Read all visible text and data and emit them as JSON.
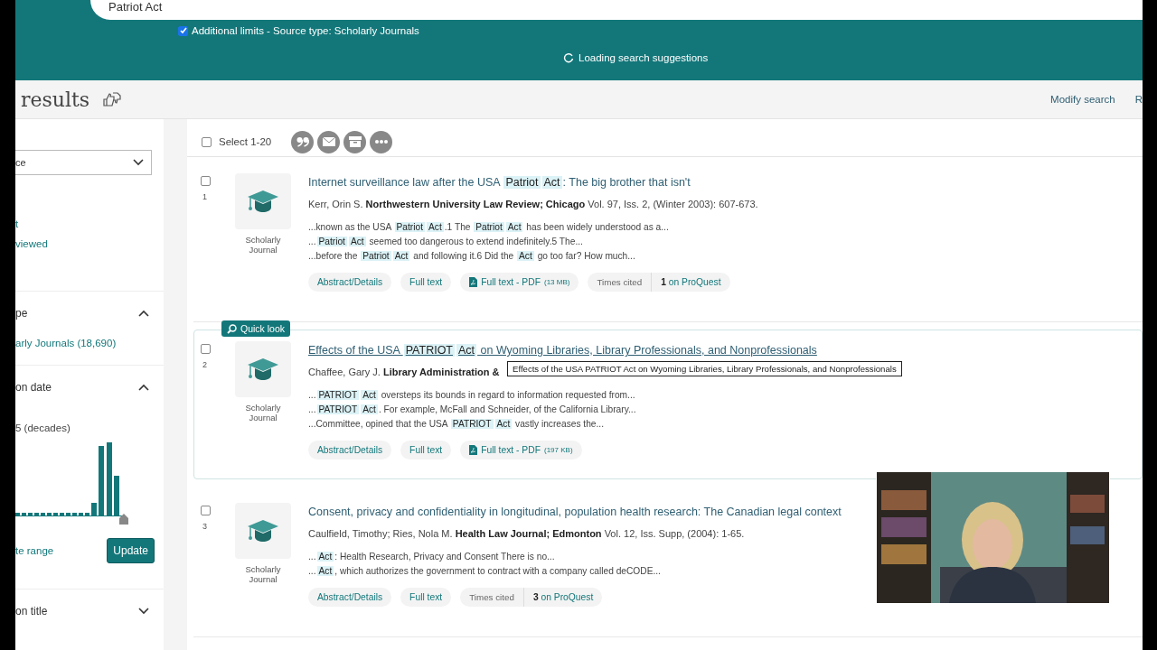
{
  "search": {
    "value": "Patriot Act",
    "limit": {
      "checked": true,
      "label": "Additional limits - Source type: Scholarly Journals"
    },
    "loading": "Loading search suggestions"
  },
  "heading": {
    "title": "results",
    "links": [
      "Modify search",
      "R"
    ]
  },
  "sidebar": {
    "dropdown": "ce",
    "sections": [
      {
        "kind": "links",
        "items": [
          "t",
          "viewed"
        ]
      },
      {
        "kind": "facet",
        "title": "pe",
        "expanded": true,
        "items": [
          "arly Journals (18,690)"
        ]
      },
      {
        "kind": "date",
        "title": "on date",
        "expanded": true,
        "caption": "5 (decades)",
        "link": "te range",
        "button": "Update"
      },
      {
        "kind": "facet",
        "title": "on title",
        "expanded": false
      }
    ]
  },
  "toolbar": {
    "select_all": {
      "checked": false,
      "label": "Select 1-20"
    }
  },
  "results": [
    {
      "number": "1",
      "selected": false,
      "hovered": false,
      "type_label": "Scholarly Journal",
      "title": [
        {
          "text": "Internet surveillance law after the USA ",
          "hit": false
        },
        {
          "text": "Patriot",
          "hit": true
        },
        {
          "text": "Act",
          "hit": true
        },
        {
          "text": ": The big brother that isn't",
          "hit": false
        }
      ],
      "byline": "Kerr, Orin S. **Northwestern University Law Review; Chicago** Vol. 97, Iss. 2,  (Winter 2003): 607-673.",
      "snippets": [
        [
          {
            "text": "...known as the USA ",
            "hit": false
          },
          {
            "text": "Patriot",
            "hit": true
          },
          {
            "text": "Act",
            "hit": true
          },
          {
            "text": ".1 The ",
            "hit": false
          },
          {
            "text": "Patriot",
            "hit": true
          },
          {
            "text": "Act",
            "hit": true
          },
          {
            "text": " has been widely understood as a...",
            "hit": false
          }
        ],
        [
          {
            "text": "...",
            "hit": false
          },
          {
            "text": "Patriot",
            "hit": true
          },
          {
            "text": "Act",
            "hit": true
          },
          {
            "text": " seemed too dangerous to extend indefinitely.5 The...",
            "hit": false
          }
        ],
        [
          {
            "text": "...before the ",
            "hit": false
          },
          {
            "text": "Patriot",
            "hit": true
          },
          {
            "text": "Act",
            "hit": true
          },
          {
            "text": " and following it.6 Did the ",
            "hit": false
          },
          {
            "text": "Act",
            "hit": true
          },
          {
            "text": " go too far? How much...",
            "hit": false
          }
        ]
      ],
      "actions": [
        {
          "kind": "link",
          "label": "Abstract/Details"
        },
        {
          "kind": "link",
          "label": "Full text"
        },
        {
          "kind": "pdf",
          "label": "Full text - PDF",
          "size": "(13 MB)"
        },
        {
          "kind": "cited",
          "label": "Times cited",
          "count": "**1** on ProQuest"
        }
      ]
    },
    {
      "number": "2",
      "selected": false,
      "hovered": true,
      "quick_look": "Quick look",
      "tooltip": "Effects of the USA PATRIOT Act on Wyoming Libraries, Library Professionals, and Nonprofessionals",
      "type_label": "Scholarly Journal",
      "title": [
        {
          "text": "Effects of the USA ",
          "hit": false
        },
        {
          "text": "PATRIOT",
          "hit": true
        },
        {
          "text": "Act",
          "hit": true
        },
        {
          "text": " on Wyoming Libraries, Library Professionals, and Nonprofessionals",
          "hit": false
        }
      ],
      "byline": "Chaffee, Gary J. **Library Administration &**",
      "snippets": [
        [
          {
            "text": "...",
            "hit": false
          },
          {
            "text": "PATRIOT",
            "hit": true
          },
          {
            "text": "Act",
            "hit": true
          },
          {
            "text": " oversteps its bounds in regard to information requested from...",
            "hit": false
          }
        ],
        [
          {
            "text": "...",
            "hit": false
          },
          {
            "text": "PATRIOT",
            "hit": true
          },
          {
            "text": "Act",
            "hit": true
          },
          {
            "text": ". For example, McFall and Schneider, of the California Library...",
            "hit": false
          }
        ],
        [
          {
            "text": "...Committee, opined that the USA ",
            "hit": false
          },
          {
            "text": "PATRIOT",
            "hit": true
          },
          {
            "text": "Act",
            "hit": true
          },
          {
            "text": " vastly increases the...",
            "hit": false
          }
        ]
      ],
      "actions": [
        {
          "kind": "link",
          "label": "Abstract/Details"
        },
        {
          "kind": "link",
          "label": "Full text"
        },
        {
          "kind": "pdf",
          "label": "Full text - PDF",
          "size": "(197 KB)"
        }
      ]
    },
    {
      "number": "3",
      "selected": false,
      "hovered": false,
      "type_label": "Scholarly Journal",
      "title": [
        {
          "text": "Consent, privacy and confidentiality in longitudinal, population health research: The Canadian legal context",
          "hit": false
        }
      ],
      "byline": "Caulfield, Timothy; Ries, Nola M. **Health Law Journal; Edmonton** Vol. 12, Iss. Supp,  (2004): 1-65.",
      "snippets": [
        [
          {
            "text": "...",
            "hit": false
          },
          {
            "text": "Act",
            "hit": true
          },
          {
            "text": ": Health Research, Privacy and Consent There is no...",
            "hit": false
          }
        ],
        [
          {
            "text": "...",
            "hit": false
          },
          {
            "text": "Act",
            "hit": true
          },
          {
            "text": ", which authorizes the government to contract with a company called deCODE...",
            "hit": false
          }
        ]
      ],
      "actions": [
        {
          "kind": "link",
          "label": "Abstract/Details"
        },
        {
          "kind": "link",
          "label": "Full text"
        },
        {
          "kind": "cited",
          "label": "Times cited",
          "count": "**3** on ProQuest"
        }
      ]
    }
  ]
}
